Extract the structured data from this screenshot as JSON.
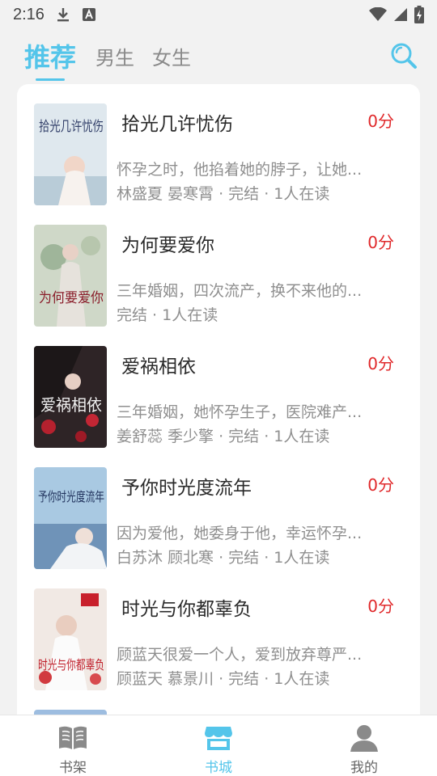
{
  "status_bar": {
    "time": "2:16"
  },
  "top_tabs": [
    {
      "label": "推荐",
      "active": true
    },
    {
      "label": "男生",
      "active": false
    },
    {
      "label": "女生",
      "active": false
    }
  ],
  "books": [
    {
      "title": "拾光几许忧伤",
      "score": "0分",
      "desc": "怀孕之时，他掐着她的脖子，让她...",
      "meta": "林盛夏 晏寒霄 · 完结 · 1人在读",
      "cover_text": "拾光几许忧伤",
      "cover_color": "#d9e4ea"
    },
    {
      "title": "为何要爱你",
      "score": "0分",
      "desc": "三年婚姻，四次流产，换不来他的...",
      "meta": "完结 · 1人在读",
      "cover_text": "为何要爱你",
      "cover_color": "#cfd7c9"
    },
    {
      "title": "爱祸相依",
      "score": "0分",
      "desc": "三年婚姻，她怀孕生子，医院难产...",
      "meta": "姜舒蕊 季少擎 · 完结 · 1人在读",
      "cover_text": "爱祸相依",
      "cover_color": "#3a2a2c"
    },
    {
      "title": "予你时光度流年",
      "score": "0分",
      "desc": "因为爱他，她委身于他，幸运怀孕...",
      "meta": "白苏沐 顾北寒 · 完结 · 1人在读",
      "cover_text": "予你时光度流年",
      "cover_color": "#9fc3e0"
    },
    {
      "title": "时光与你都辜负",
      "score": "0分",
      "desc": "顾蓝天很爱一个人，爱到放弃尊严...",
      "meta": "顾蓝天 慕景川 · 完结 · 1人在读",
      "cover_text": "时光与你都辜负",
      "cover_color": "#efe6e2"
    }
  ],
  "bottom_nav": [
    {
      "label": "书架",
      "icon": "book-icon",
      "active": false
    },
    {
      "label": "书城",
      "icon": "store-icon",
      "active": true
    },
    {
      "label": "我的",
      "icon": "person-icon",
      "active": false
    }
  ],
  "colors": {
    "accent": "#54c5ea",
    "score": "#e0282a"
  }
}
